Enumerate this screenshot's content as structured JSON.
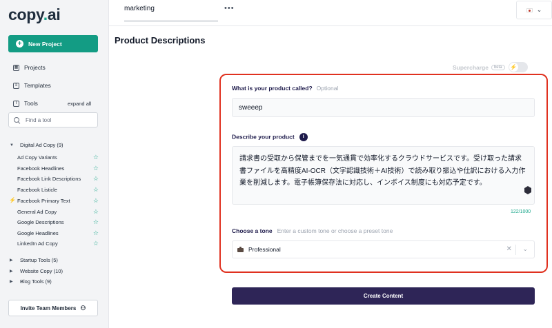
{
  "brand": {
    "logo_main": "copy",
    "logo_dot": ".",
    "logo_end": "ai"
  },
  "sidebar": {
    "new_project": "New Project",
    "nav": [
      {
        "label": "Projects",
        "icon": "grid-icon"
      },
      {
        "label": "Templates",
        "icon": "document-icon"
      },
      {
        "label": "Tools",
        "icon": "toolbox-icon"
      }
    ],
    "expand_all": "expand all",
    "search_placeholder": "Find a tool",
    "digital_ad_copy": {
      "label": "Digital Ad Copy (9)",
      "expanded": true,
      "tools": [
        "Ad Copy Variants",
        "Facebook Headlines",
        "Facebook Link Descriptions",
        "Facebook Listicle",
        "Facebook Primary Text",
        "General Ad Copy",
        "Google Descriptions",
        "Google Headlines",
        "LinkedIn Ad Copy"
      ]
    },
    "collapsed_groups": [
      "Startup Tools (5)",
      "Website Copy (10)",
      "Blog Tools (9)"
    ],
    "invite": "Invite Team Members"
  },
  "topbar": {
    "tab": "marketing",
    "more": "•••"
  },
  "page": {
    "title": "Product Descriptions"
  },
  "supercharge": {
    "label": "Supercharge",
    "badge": "beta"
  },
  "form": {
    "product_label": "What is your product called?",
    "optional": "Optional",
    "product_value": "sweeep",
    "describe_label": "Describe your product",
    "description": "請求書の受取から保管までを一気通貫で効率化するクラウドサービスです。受け取った請求書ファイルを高精度AI-OCR（文字認識技術＋AI技術）で読み取り振込や仕訳における入力作業を削減します。電子帳簿保存法に対応し、インボイス制度にも対応予定です。",
    "counter": "122/1000",
    "tone_label": "Choose a tone",
    "tone_placeholder": "Enter a custom tone or choose a preset tone",
    "tone_value": "Professional"
  },
  "create_button": "Create Content",
  "colors": {
    "accent": "#139c84",
    "primary": "#2e2557",
    "highlight_border": "#e0311f"
  }
}
